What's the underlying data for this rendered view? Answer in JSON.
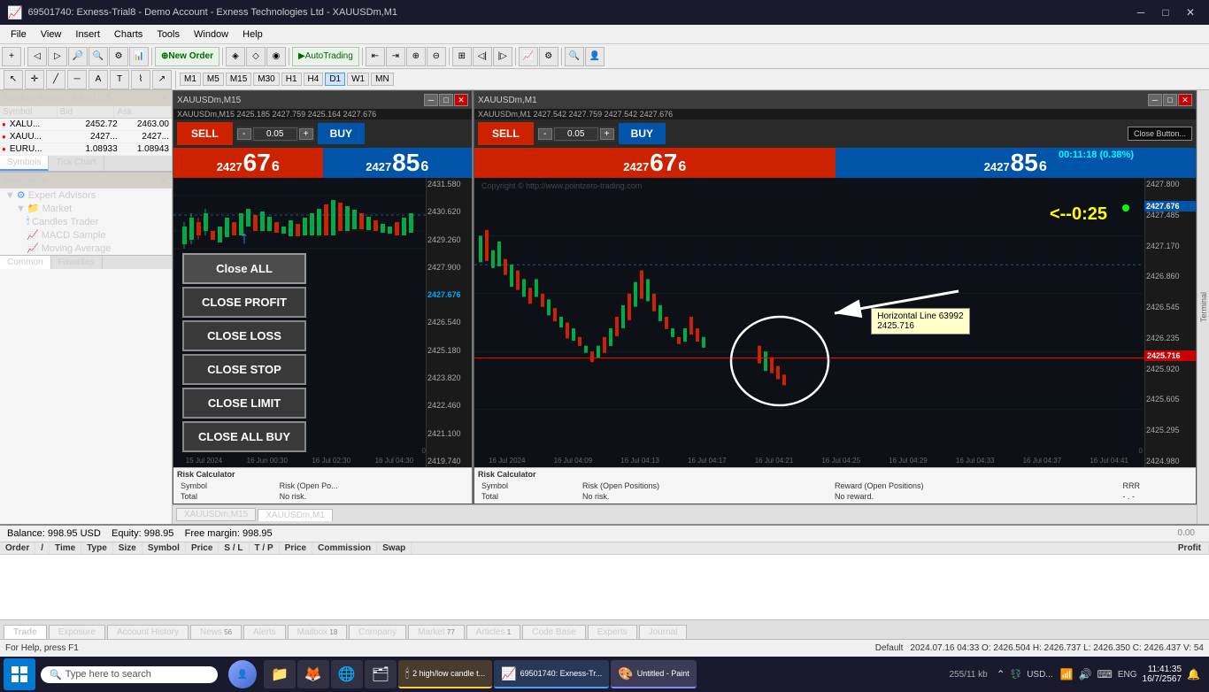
{
  "titleBar": {
    "title": "69501740: Exness-Trial8 - Demo Account - Exness Technologies Ltd - XAUUSDm,M1",
    "icon": "📈"
  },
  "menuBar": {
    "items": [
      "File",
      "View",
      "Insert",
      "Charts",
      "Tools",
      "Window",
      "Help"
    ]
  },
  "toolbar": {
    "newOrderLabel": "New Order",
    "autoTradingLabel": "AutoTrading"
  },
  "timeframes": {
    "buttons": [
      "M1",
      "M5",
      "M15",
      "M30",
      "H1",
      "H4",
      "D1",
      "W1",
      "MN"
    ],
    "active": "M1"
  },
  "marketWatch": {
    "title": "Market Watch: 04:41:35",
    "headers": [
      "Symbol",
      "Bid",
      "Ask"
    ],
    "rows": [
      {
        "symbol": "XALU...",
        "bid": "2452.72",
        "ask": "2463.00"
      },
      {
        "symbol": "XAUU...",
        "bid": "2427...",
        "ask": "2427..."
      },
      {
        "symbol": "EURU...",
        "bid": "1.08933",
        "ask": "1.08943"
      }
    ],
    "tabs": [
      "Symbols",
      "Tick Chart"
    ]
  },
  "navigator": {
    "title": "Navigator",
    "tree": {
      "expertAdvisors": {
        "label": "Expert Advisors",
        "children": [
          {
            "label": "Market",
            "children": [
              {
                "label": "Candles Trader"
              },
              {
                "label": "MACD Sample"
              },
              {
                "label": "Moving Average"
              }
            ]
          }
        ]
      }
    },
    "tabs": [
      "Common",
      "Favorites"
    ]
  },
  "chartM15": {
    "title": "XAUUSDm,M15",
    "infoBar": "XAUUSDm,M15  2425.185  2427.759  2425.164  2427.676",
    "prices": {
      "level": "2431.580",
      "levels": [
        "2430.620",
        "2429.260",
        "2427.900",
        "2426.540",
        "2425.180",
        "2423.820",
        "2422.460",
        "2421.100",
        "2419.740"
      ]
    },
    "rightPrice": "2427.676",
    "sell": {
      "label": "SELL",
      "lot": "0.05",
      "pricePrefix": "2427",
      "priceMain": "67",
      "priceSup": "6"
    },
    "buy": {
      "label": "BUY",
      "lot": "0.05",
      "pricePrefix": "2427",
      "priceMain": "85",
      "priceSup": "6"
    },
    "riskCalc": {
      "title": "Risk Calculator",
      "symbolLabel": "Symbol",
      "riskLabel": "Risk (Open Po...",
      "totalLabel": "Total",
      "noRisk": "No risk."
    },
    "dates": [
      "15 Jul 2024",
      "16 Jun 00:30",
      "16 Jul 02:30",
      "16 Jul 04:30"
    ]
  },
  "chartM1": {
    "title": "XAUUSDm,M1",
    "infoBar": "XAUUSDm,M1  2427.542  2427.759  2427.542  2427.676",
    "rightPrice": "2427.800",
    "rightPriceBlue": "2427.676",
    "timer": "00:11:18 (0.38%)",
    "countdown": "<--0:25",
    "sell": {
      "label": "SELL",
      "lot": "0.05",
      "pricePrefix": "2427",
      "priceMain": "67",
      "priceSup": "6"
    },
    "buy": {
      "label": "BUY",
      "lot": "0.05",
      "pricePrefix": "2427",
      "priceMain": "85",
      "priceSup": "6"
    },
    "prices": {
      "levels": [
        "2427.800",
        "2427.485",
        "2427.170",
        "2426.860",
        "2426.545",
        "2426.235",
        "2425.920",
        "2425.605",
        "2425.295",
        "2424.980"
      ]
    },
    "redLine": "2425.716",
    "redLineLabel": "2425.716",
    "tooltip": {
      "label": "Horizontal Line 63992",
      "value": "2425.716"
    },
    "closeButtonLabel": "Close Button...",
    "riskCalc": {
      "title": "Risk Calculator",
      "symbolLabel": "Symbol",
      "riskLabel": "Risk (Open Positions)",
      "rewardLabel": "Reward (Open Positions)",
      "rrrLabel": "RRR",
      "totalLabel": "Total",
      "noRisk": "No risk.",
      "noReward": "No reward.",
      "dashes": "- . -"
    },
    "dates": [
      "16 Jul 2024",
      "16 Jul 04:09",
      "16 Jul 04:13",
      "16 Jul 04:17",
      "16 Jul 04:21",
      "16 Jul 04:25",
      "16 Jul 04:29",
      "16 Jul 04:33",
      "16 Jul 04:37",
      "16 Jul 04:41"
    ],
    "copyright": "Copyright © http://www.pointzero-trading.com"
  },
  "closeButtons": {
    "upArrow": "↑",
    "buttons": [
      {
        "label": "Close ALL",
        "id": "close-all"
      },
      {
        "label": "CLOSE PROFIT",
        "id": "close-profit"
      },
      {
        "label": "CLOSE LOSS",
        "id": "close-loss"
      },
      {
        "label": "CLOSE STOP",
        "id": "close-stop"
      },
      {
        "label": "CLOSE LIMIT",
        "id": "close-limit"
      },
      {
        "label": "CLOSE ALL BUY",
        "id": "close-all-buy"
      }
    ]
  },
  "chartTabs": [
    "XAUUSDm,M15",
    "XAUUSDm,M1"
  ],
  "terminal": {
    "label": "Terminal",
    "columns": [
      "Order",
      "/",
      "Time",
      "Type",
      "Size",
      "Symbol",
      "Price",
      "S / L",
      "T / P",
      "Price",
      "Commission",
      "Swap",
      "Profit"
    ],
    "balanceLabel": "Balance: 998.95 USD",
    "equityLabel": "Equity: 998.95",
    "marginLabel": "Free margin: 998.95",
    "profitValue": "0.00",
    "tabs": [
      {
        "label": "Trade",
        "active": true
      },
      {
        "label": "Exposure"
      },
      {
        "label": "Account History"
      },
      {
        "label": "News",
        "badge": "56"
      },
      {
        "label": "Alerts"
      },
      {
        "label": "Mailbox",
        "badge": "18"
      },
      {
        "label": "Company"
      },
      {
        "label": "Market",
        "badge": "77"
      },
      {
        "label": "Articles",
        "badge": "1"
      },
      {
        "label": "Code Base"
      },
      {
        "label": "Experts"
      },
      {
        "label": "Journal"
      }
    ]
  },
  "statusBar": {
    "helpText": "For Help, press F1",
    "profile": "Default",
    "ohlcv": "2024.07.16 04:33  O: 2426.504  H: 2426.737  L: 2426.350  C: 2426.437  V: 54"
  },
  "taskbar": {
    "searchPlaceholder": "Type here to search",
    "items": [
      {
        "label": "2 high/low candle t...",
        "icon": "candle"
      },
      {
        "label": "69501740: Exness-Tr...",
        "icon": "mt5"
      },
      {
        "label": "Untitled - Paint",
        "icon": "paint"
      }
    ],
    "systray": {
      "forex": "USD...",
      "time": "11:41:35",
      "date": "16/7/2567",
      "lang": "ENG",
      "notify": "255/11 kb"
    }
  }
}
